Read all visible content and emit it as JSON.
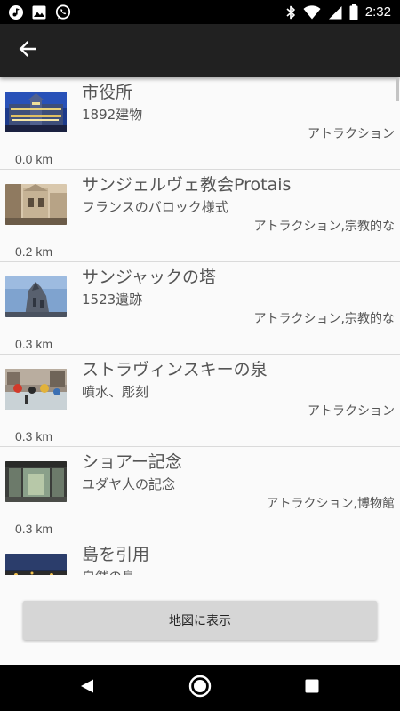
{
  "status_bar": {
    "time": "2:32",
    "left_icons": [
      "music-icon",
      "image-icon",
      "whatsapp-icon"
    ],
    "right_icons": [
      "bluetooth-icon",
      "wifi-icon",
      "signal-icon",
      "battery-icon"
    ]
  },
  "app_bar": {
    "back_icon": "arrow-back-icon"
  },
  "places": [
    {
      "name": "市役所",
      "description": "1892建物",
      "category": "アトラクション",
      "distance": "0.0 km"
    },
    {
      "name": "サンジェルヴェ教会Protais",
      "description": "フランスのバロック様式",
      "category": "アトラクション,宗教的な",
      "distance": "0.2 km"
    },
    {
      "name": "サンジャックの塔",
      "description": "1523遺跡",
      "category": "アトラクション,宗教的な",
      "distance": "0.3 km"
    },
    {
      "name": "ストラヴィンスキーの泉",
      "description": "噴水、彫刻",
      "category": "アトラクション",
      "distance": "0.3 km"
    },
    {
      "name": "ショアー記念",
      "description": "ユダヤ人の記念",
      "category": "アトラクション,博物館",
      "distance": "0.3 km"
    },
    {
      "name": "島を引用",
      "description": "自然の島",
      "category": "",
      "distance": ""
    }
  ],
  "map_button": {
    "label": "地図に表示"
  },
  "nav_bar": {
    "icons": [
      "back-triangle-icon",
      "home-circle-icon",
      "recents-square-icon"
    ]
  }
}
